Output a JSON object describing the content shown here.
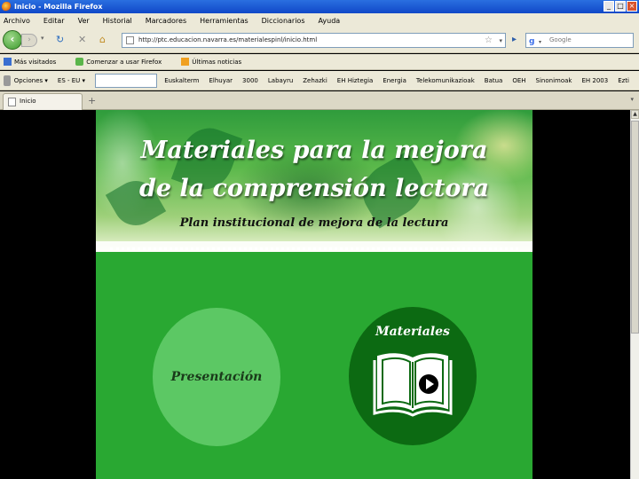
{
  "window": {
    "title": "Inicio - Mozilla Firefox",
    "buttons": [
      "_",
      "□",
      "×"
    ]
  },
  "menu": [
    "Archivo",
    "Editar",
    "Ver",
    "Historial",
    "Marcadores",
    "Herramientas",
    "Diccionarios",
    "Ayuda"
  ],
  "nav": {
    "back_icon": "back-arrow-icon",
    "forward_icon": "forward-arrow-icon",
    "url": "http://ptc.educacion.navarra.es/materialespinl/inicio.html",
    "search_placeholder": "Google"
  },
  "bookmarks": [
    {
      "label": "Más visitados",
      "icon": "blue"
    },
    {
      "label": "Comenzar a usar Firefox",
      "icon": "green"
    },
    {
      "label": "Últimas noticias",
      "icon": "orange"
    }
  ],
  "elhuyar_toolbar": {
    "options_label": "Opciones",
    "lang_label": "ES - EU",
    "items": [
      "Euskalterm",
      "Elhuyar",
      "3000",
      "Labayru",
      "Zehazki",
      "EH Hiztegia",
      "Energia",
      "Telekomunikazioak",
      "Batua",
      "OEH",
      "Sinonimoak",
      "EH 2003",
      "Ezti"
    ]
  },
  "tab": {
    "label": "Inicio",
    "add_label": "+",
    "list_label": "▾"
  },
  "page": {
    "title_line1": "Materiales para la mejora",
    "title_line2": "de la comprensión lectora",
    "subtitle": "Plan institucional de mejora de la lectura",
    "presentation_label": "Presentación",
    "materials_label": "Materiales"
  },
  "colors": {
    "page_green": "#29a832",
    "presentation_circle": "#5cc864",
    "materials_circle": "#0c6a12",
    "titlebar": "#1048c8"
  }
}
